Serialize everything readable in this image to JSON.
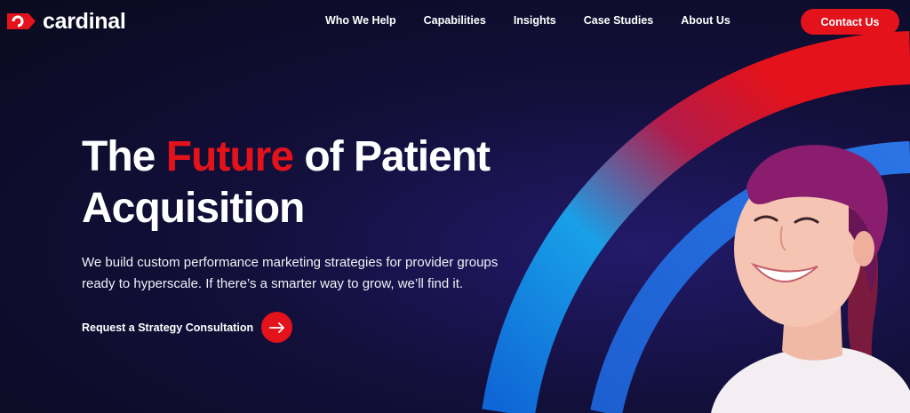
{
  "brand": {
    "name": "cardinal",
    "accent": "#e3121b"
  },
  "nav": {
    "items": [
      {
        "label": "Who We Help"
      },
      {
        "label": "Capabilities"
      },
      {
        "label": "Insights"
      },
      {
        "label": "Case Studies"
      },
      {
        "label": "About Us"
      }
    ],
    "contact_label": "Contact Us"
  },
  "hero": {
    "title_pre": "The",
    "title_accent": "Future",
    "title_post_line1": "of Patient",
    "title_line2": "Acquisition",
    "subtitle": "We build custom performance marketing strategies for provider groups ready to hyperscale. If there’s a smarter way to grow, we’ll find it.",
    "cta_label": "Request a Strategy Consultation",
    "cta_icon": "arrow-right-icon"
  },
  "colors": {
    "background": "#0a0a1e",
    "arc_red": "#e3121b",
    "arc_blue": "#1a8fe0"
  }
}
